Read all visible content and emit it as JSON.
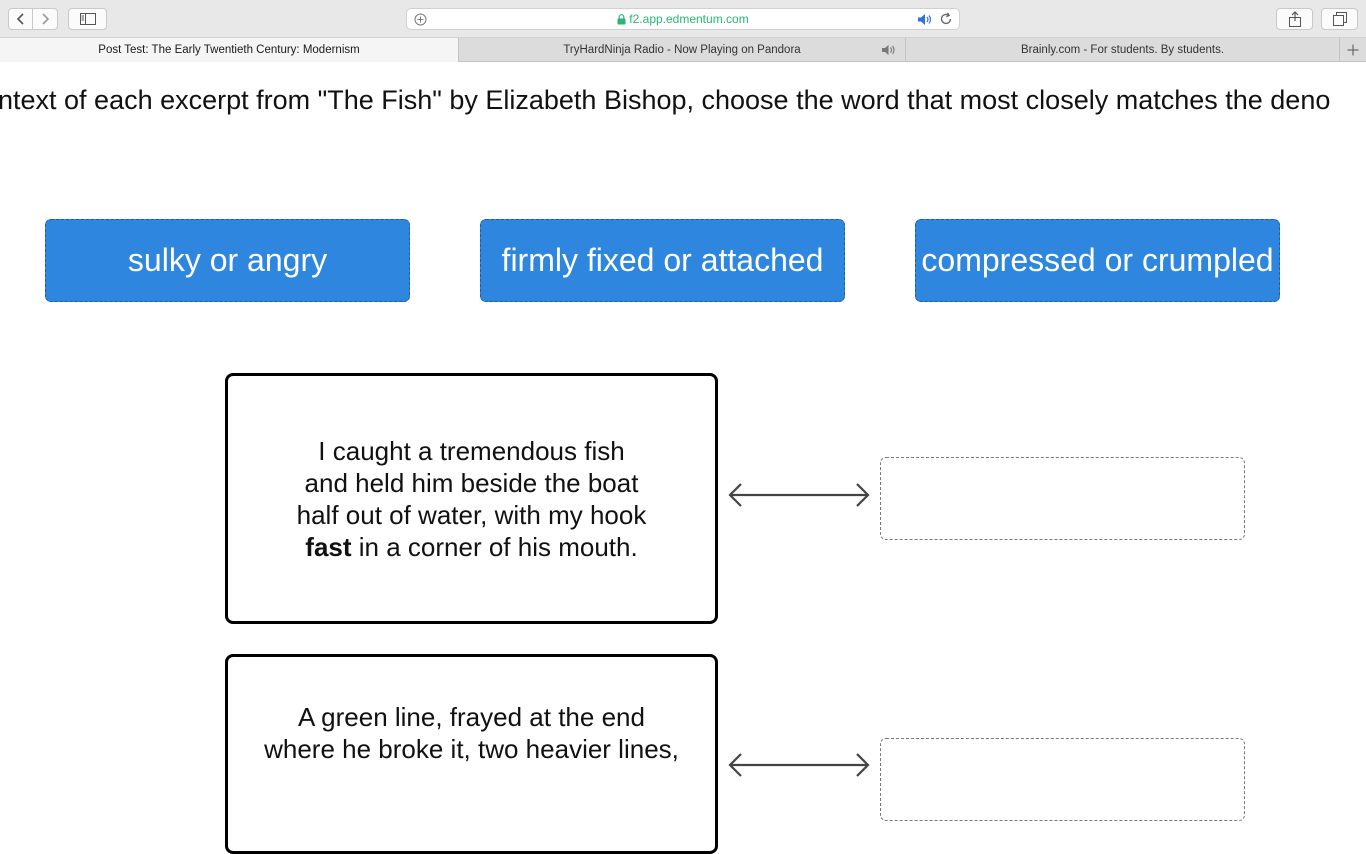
{
  "browser": {
    "url": "f2.app.edmentum.com",
    "tabs": [
      {
        "title": "Post Test: The Early Twentieth Century: Modernism",
        "active": true
      },
      {
        "title": "TryHardNinja Radio - Now Playing on Pandora",
        "active": false,
        "playing_audio": true
      },
      {
        "title": "Brainly.com - For students. By students.",
        "active": false
      }
    ],
    "icons": {
      "back": "chevron-left-icon",
      "forward": "chevron-right-icon",
      "sidebar": "sidebar-icon",
      "add_site": "plus-circle-icon",
      "lock": "lock-icon",
      "audio": "speaker-icon",
      "reload": "reload-icon",
      "share": "share-icon",
      "tab_overview": "tabs-overview-icon",
      "new_tab": "plus-icon"
    },
    "colors": {
      "url_secure": "#2bb673",
      "audio_active": "#2f6fe0"
    }
  },
  "question": {
    "instructions": "ntext of each excerpt from \"The Fish\" by Elizabeth Bishop, choose the word that most closely matches the deno",
    "answer_tiles": [
      "sulky or angry",
      "firmly fixed or attached",
      "compressed or crumpled"
    ],
    "pairs": [
      {
        "excerpt_lines": [
          {
            "text": "I caught a tremendous fish"
          },
          {
            "text": "and held him beside the boat"
          },
          {
            "text": "half out of water, with my hook"
          },
          {
            "bold": "fast",
            "text": " in a corner of his mouth."
          }
        ],
        "drop_value": ""
      },
      {
        "excerpt_lines": [
          {
            "text": "A green line, frayed at the end"
          },
          {
            "text": "where he broke it, two heavier lines,"
          }
        ],
        "drop_value": ""
      }
    ],
    "colors": {
      "tile_bg": "#2e86de",
      "tile_text": "#ffffff"
    }
  }
}
